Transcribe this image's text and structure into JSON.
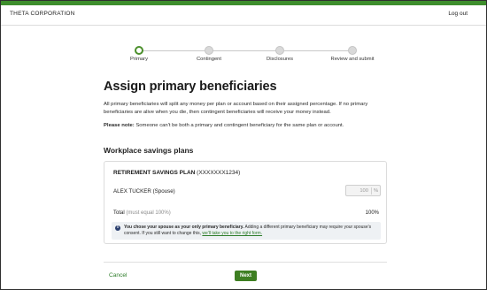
{
  "header": {
    "brand": "THETA CORPORATION",
    "logout_label": "Log out"
  },
  "stepper": {
    "steps": [
      {
        "label": "Primary",
        "state": "active"
      },
      {
        "label": "Contingent",
        "state": "inactive"
      },
      {
        "label": "Disclosures",
        "state": "inactive"
      },
      {
        "label": "Review and submit",
        "state": "inactive"
      }
    ]
  },
  "main": {
    "title": "Assign primary beneficiaries",
    "description": "All primary beneficiaries will split any money per plan or account based on their assigned percentage. If no primary beneficiaries are alive when you die, then contingent beneficiaries will receive your money instead.",
    "note_label": "Please note:",
    "note_text": " Someone can't be both a primary and contingent beneficiary for the same plan or account.",
    "section_title": "Workplace savings plans"
  },
  "plan": {
    "name": "RETIREMENT SAVINGS PLAN",
    "account": " (XXXXXXX1234)",
    "beneficiary": {
      "name": "ALEX TUCKER (Spouse)",
      "percent_value": "100",
      "percent_sign": "%"
    },
    "total_label": "Total",
    "total_hint": " (must equal 100%)",
    "total_value": "100%",
    "info": {
      "bold": "You chose your spouse as your only primary beneficiary.",
      "text": " Adding a different primary beneficiary may require your spouse's consent. If you still want to change this, ",
      "link": "we'll take you to the right form."
    }
  },
  "footer": {
    "cancel_label": "Cancel",
    "next_label": "Next"
  },
  "colors": {
    "brand_green": "#3e8e2d",
    "link_green": "#2e7d2a",
    "info_bg": "#eef1f4"
  }
}
